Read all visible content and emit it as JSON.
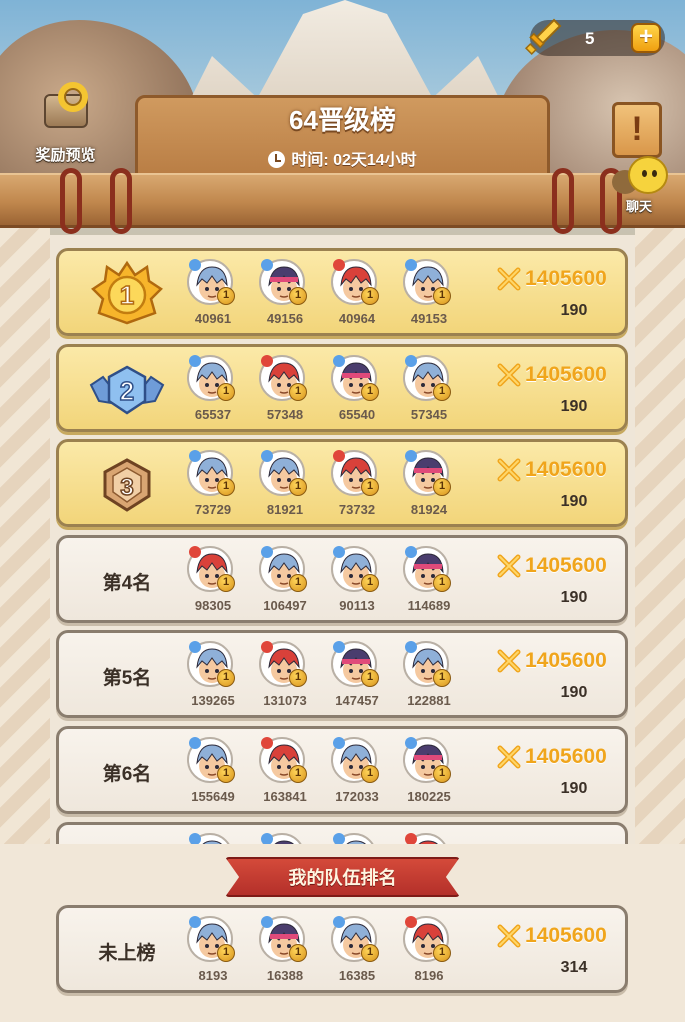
{
  "header": {
    "title": "64晋级榜",
    "timer_text": "时间: 02天14小时",
    "reward_label": "奖励预览",
    "chat_label": "聊天",
    "scroll_glyph": "!",
    "currency": {
      "count": "5",
      "plus": "+"
    }
  },
  "colors": {
    "gold_row": "#f2d57a",
    "power": "#f0a51c",
    "ribbon": "#c43a30"
  },
  "rankings": [
    {
      "rank_icon": "medal-1",
      "rank_text": "",
      "members": [
        {
          "hair": "blue",
          "uid": "40961"
        },
        {
          "hair": "purple",
          "uid": "49156"
        },
        {
          "hair": "red",
          "uid": "40964"
        },
        {
          "hair": "blue",
          "uid": "49153"
        }
      ],
      "power": "1405600",
      "score": "190"
    },
    {
      "rank_icon": "medal-2",
      "rank_text": "",
      "members": [
        {
          "hair": "blue",
          "uid": "65537"
        },
        {
          "hair": "red",
          "uid": "57348"
        },
        {
          "hair": "purple",
          "uid": "65540"
        },
        {
          "hair": "blue",
          "uid": "57345"
        }
      ],
      "power": "1405600",
      "score": "190"
    },
    {
      "rank_icon": "medal-3",
      "rank_text": "",
      "members": [
        {
          "hair": "blue",
          "uid": "73729"
        },
        {
          "hair": "blue",
          "uid": "81921"
        },
        {
          "hair": "red",
          "uid": "73732"
        },
        {
          "hair": "purple",
          "uid": "81924"
        }
      ],
      "power": "1405600",
      "score": "190"
    },
    {
      "rank_icon": "",
      "rank_text": "第4名",
      "members": [
        {
          "hair": "red",
          "uid": "98305"
        },
        {
          "hair": "blue",
          "uid": "106497"
        },
        {
          "hair": "blue",
          "uid": "90113"
        },
        {
          "hair": "purple",
          "uid": "114689"
        }
      ],
      "power": "1405600",
      "score": "190"
    },
    {
      "rank_icon": "",
      "rank_text": "第5名",
      "members": [
        {
          "hair": "blue",
          "uid": "139265"
        },
        {
          "hair": "red",
          "uid": "131073"
        },
        {
          "hair": "purple",
          "uid": "147457"
        },
        {
          "hair": "blue",
          "uid": "122881"
        }
      ],
      "power": "1405600",
      "score": "190"
    },
    {
      "rank_icon": "",
      "rank_text": "第6名",
      "members": [
        {
          "hair": "blue",
          "uid": "155649"
        },
        {
          "hair": "red",
          "uid": "163841"
        },
        {
          "hair": "blue",
          "uid": "172033"
        },
        {
          "hair": "purple",
          "uid": "180225"
        }
      ],
      "power": "1405600",
      "score": "190"
    },
    {
      "rank_icon": "",
      "rank_text": "",
      "members": [
        {
          "hair": "blue",
          "uid": ""
        },
        {
          "hair": "purple",
          "uid": ""
        },
        {
          "hair": "blue",
          "uid": ""
        },
        {
          "hair": "red",
          "uid": ""
        }
      ],
      "power": "",
      "score": ""
    }
  ],
  "my_team": {
    "title": "我的队伍排名",
    "rank_text": "未上榜",
    "members": [
      {
        "hair": "blue",
        "uid": "8193"
      },
      {
        "hair": "purple",
        "uid": "16388"
      },
      {
        "hair": "blue",
        "uid": "16385"
      },
      {
        "hair": "red",
        "uid": "8196"
      }
    ],
    "power": "1405600",
    "score": "314"
  },
  "member_level": "1"
}
